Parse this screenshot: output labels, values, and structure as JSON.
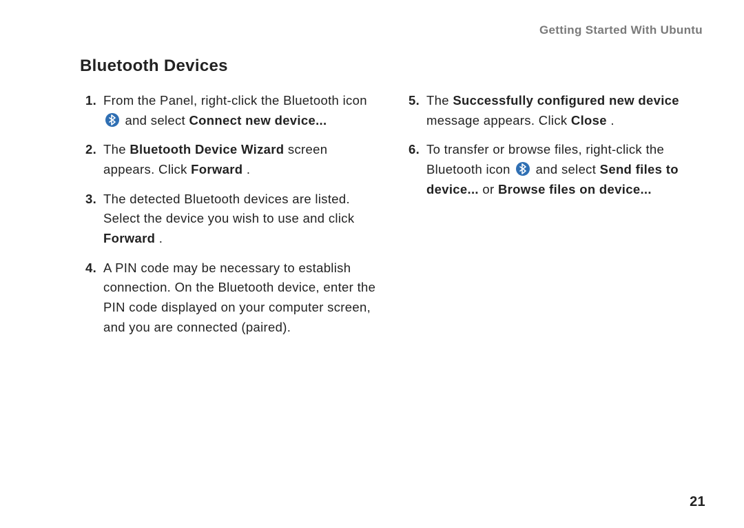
{
  "running_header": "Getting Started With Ubuntu",
  "section_title": "Bluetooth Devices",
  "icon_name": "bluetooth-icon",
  "items": {
    "i1": {
      "num": "1.",
      "frag_a": "From the Panel, right-click the Bluetooth icon ",
      "frag_b": " and select ",
      "bold": "Connect new device..."
    },
    "i2": {
      "num": "2.",
      "frag_a": "The ",
      "bold_a": "Bluetooth Device Wizard",
      "frag_b": " screen appears. Click ",
      "bold_b": "Forward",
      "frag_c": "."
    },
    "i3": {
      "num": "3.",
      "frag_a": "The detected Bluetooth devices are listed. Select the device you wish to use and click ",
      "bold": "Forward",
      "frag_b": "."
    },
    "i4": {
      "num": "4.",
      "frag_a": "A PIN code may be necessary to establish connection. On the Bluetooth device, enter the PIN code displayed on your computer screen, and you are connected (paired)."
    },
    "i5": {
      "num": "5.",
      "frag_a": "The ",
      "bold_a": "Successfully configured new device",
      "frag_b": " message appears. Click ",
      "bold_b": "Close",
      "frag_c": "."
    },
    "i6": {
      "num": "6.",
      "frag_a": "To transfer or browse files, right-click the Bluetooth icon ",
      "frag_b": " and select ",
      "bold_a": "Send files to device...",
      "frag_c": " or ",
      "bold_b": "Browse files on device..."
    }
  },
  "page_number": "21"
}
